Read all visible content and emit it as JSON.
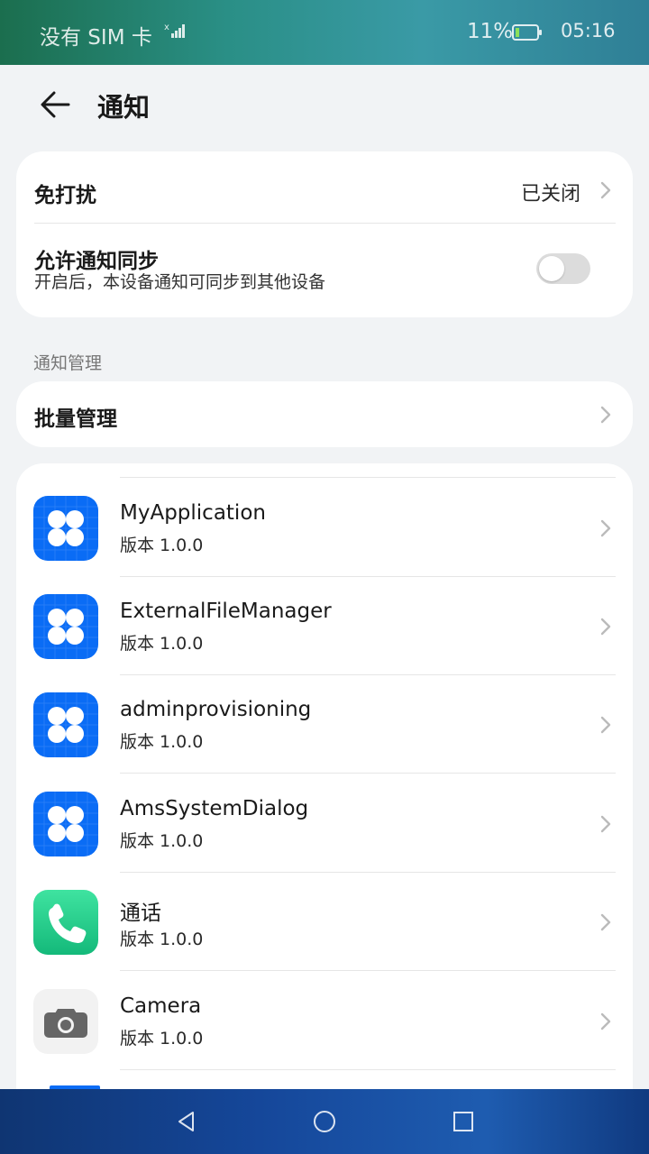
{
  "status_bar": {
    "carrier": "没有 SIM 卡",
    "battery_percent": "11%",
    "time": "05:16"
  },
  "header": {
    "title": "通知"
  },
  "dnd": {
    "label": "免打扰",
    "value": "已关闭"
  },
  "sync": {
    "label": "允许通知同步",
    "subtitle": "开启后，本设备通知可同步到其他设备",
    "enabled": false
  },
  "section": {
    "label": "通知管理"
  },
  "batch": {
    "label": "批量管理"
  },
  "apps": [
    {
      "name": "MyApplication",
      "version": "版本 1.0.0",
      "icon": "default-app-icon"
    },
    {
      "name": "ExternalFileManager",
      "version": "版本 1.0.0",
      "icon": "default-app-icon"
    },
    {
      "name": "adminprovisioning",
      "version": "版本 1.0.0",
      "icon": "default-app-icon"
    },
    {
      "name": "AmsSystemDialog",
      "version": "版本 1.0.0",
      "icon": "default-app-icon"
    },
    {
      "name": "通话",
      "version": "版本 1.0.0",
      "icon": "phone-icon"
    },
    {
      "name": "Camera",
      "version": "版本 1.0.0",
      "icon": "camera-icon"
    }
  ],
  "colors": {
    "app_blue": "#0a6cf5",
    "call_green": "#2dd08a",
    "page_bg": "#f1f3f5"
  }
}
